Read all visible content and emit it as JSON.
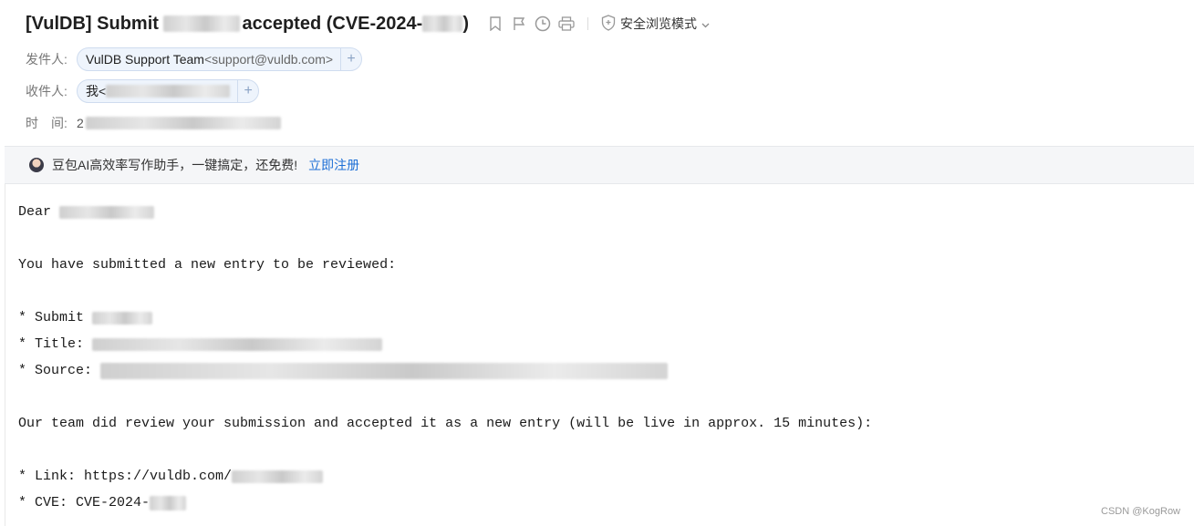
{
  "email": {
    "subject_prefix": "[VulDB] Submit ",
    "subject_middle": "accepted (CVE-2024-",
    "subject_suffix": ")",
    "safe_mode_label": "安全浏览模式",
    "from": {
      "label": "发件人:",
      "name": "VulDB Support Team",
      "address": "<support@vuldb.com>"
    },
    "to": {
      "label": "收件人:",
      "name": "我<"
    },
    "time": {
      "label": "时　间:",
      "value_visible": "2"
    }
  },
  "ad_bar": {
    "text": "豆包AI高效率写作助手，一键搞定，还免费!",
    "link": "立即注册"
  },
  "body": {
    "greeting": "Dear ",
    "intro": "You have submitted a new entry to be reviewed:",
    "item_submit": "* Submit ",
    "item_title": "* Title: ",
    "item_source": "* Source: ",
    "accepted": "Our team did review your submission and accepted it as a new entry (will be live in approx. 15 minutes):",
    "item_link": "* Link: https://vuldb.com/",
    "item_cve": "* CVE: CVE-2024-"
  },
  "watermark": "CSDN @KogRow",
  "icons": [
    "bookmark-icon",
    "flag-icon",
    "clock-icon",
    "print-icon",
    "shield-icon",
    "chevron-down-icon",
    "plus-icon",
    "avatar"
  ],
  "colors": {
    "link": "#1d6fd6",
    "chip_bg": "#eef4fc",
    "chip_border": "#cfdcef",
    "ad_bg": "#f5f6f8"
  }
}
